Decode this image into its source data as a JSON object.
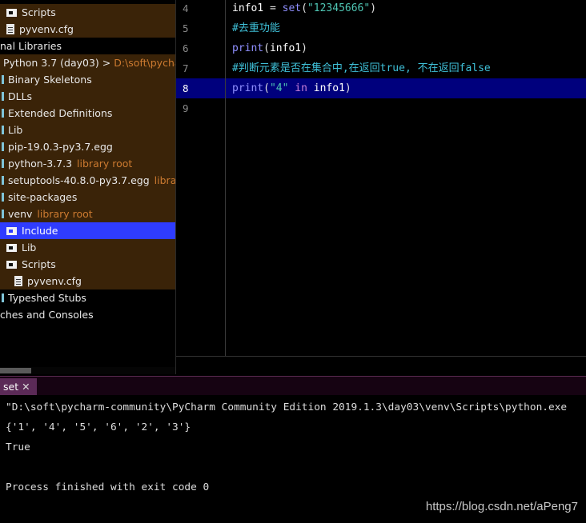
{
  "tree": {
    "items": [
      {
        "icon": "folder-icon",
        "label": "Scripts",
        "hint": ""
      },
      {
        "icon": "file-icon",
        "label": "pyvenv.cfg",
        "hint": ""
      },
      {
        "icon": "",
        "label": "nal Libraries",
        "hint": ""
      },
      {
        "icon": "",
        "label": "Python 3.7 (day03) > ",
        "hint": "D:\\soft\\pycharm"
      },
      {
        "icon": "stub-icon",
        "label": "Binary Skeletons",
        "hint": ""
      },
      {
        "icon": "stub-icon",
        "label": "DLLs",
        "hint": ""
      },
      {
        "icon": "stub-icon",
        "label": "Extended Definitions",
        "hint": ""
      },
      {
        "icon": "stub-icon",
        "label": "Lib",
        "hint": ""
      },
      {
        "icon": "stub-icon",
        "label": "pip-19.0.3-py3.7.egg",
        "hint": ""
      },
      {
        "icon": "stub-icon",
        "label": "python-3.7.3",
        "hint": "library root"
      },
      {
        "icon": "stub-icon",
        "label": "setuptools-40.8.0-py3.7.egg",
        "hint": "library r"
      },
      {
        "icon": "stub-icon",
        "label": "site-packages",
        "hint": ""
      },
      {
        "icon": "stub-icon",
        "label": "venv",
        "hint": "library root"
      },
      {
        "icon": "folder-icon",
        "label": "Include",
        "hint": ""
      },
      {
        "icon": "folder-icon",
        "label": "Lib",
        "hint": ""
      },
      {
        "icon": "folder-icon",
        "label": "Scripts",
        "hint": ""
      },
      {
        "icon": "file-icon",
        "label": "pyvenv.cfg",
        "hint": ""
      },
      {
        "icon": "stub-icon",
        "label": "Typeshed Stubs",
        "hint": ""
      },
      {
        "icon": "",
        "label": "ches and Consoles",
        "hint": ""
      }
    ]
  },
  "editor": {
    "lines": [
      {
        "num": "4",
        "tokens": [
          [
            "var",
            "info1"
          ],
          [
            "op",
            " = "
          ],
          [
            "fn",
            "set"
          ],
          [
            "op",
            "("
          ],
          [
            "str",
            "\"12345666\""
          ],
          [
            "op",
            ")"
          ]
        ]
      },
      {
        "num": "5",
        "tokens": [
          [
            "cmt",
            "#去重功能"
          ]
        ]
      },
      {
        "num": "6",
        "tokens": [
          [
            "fn",
            "print"
          ],
          [
            "op",
            "("
          ],
          [
            "var",
            "info1"
          ],
          [
            "op",
            ")"
          ]
        ]
      },
      {
        "num": "7",
        "tokens": [
          [
            "cmt",
            "#判断元素是否在集合中,在返回true, 不在返回false"
          ]
        ]
      },
      {
        "num": "8",
        "tokens": [
          [
            "fn",
            "print"
          ],
          [
            "op",
            "("
          ],
          [
            "str",
            "\"4\""
          ],
          [
            "op",
            " "
          ],
          [
            "kw",
            "in"
          ],
          [
            "op",
            " "
          ],
          [
            "var",
            "info1"
          ],
          [
            "op",
            ")"
          ]
        ]
      },
      {
        "num": "9",
        "tokens": []
      }
    ],
    "current_line": "8"
  },
  "run": {
    "tab_label": "set",
    "close_glyph": "✕",
    "output": [
      "\"D:\\soft\\pycharm-community\\PyCharm Community Edition 2019.1.3\\day03\\venv\\Scripts\\python.exe",
      "{'1', '4', '5', '6', '2', '3'}",
      "True",
      "",
      "Process finished with exit code 0"
    ]
  },
  "watermark": "https://blog.csdn.net/aPeng7",
  "colors": {
    "tree_highlight": "#3a2308",
    "selection": "#2f3cff",
    "current_line": "#00007d",
    "hint": "#cc7a30"
  }
}
